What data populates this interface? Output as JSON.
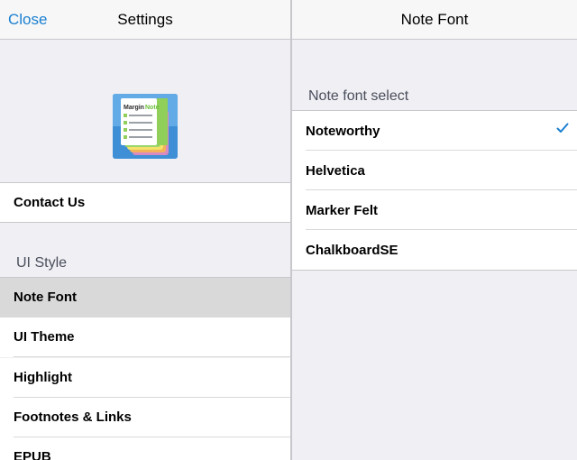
{
  "settings": {
    "close_label": "Close",
    "title": "Settings",
    "app_icon_text": "MarginNote",
    "contact_label": "Contact Us",
    "section_ui_style": "UI Style",
    "items": [
      {
        "label": "Note Font",
        "selected": true
      },
      {
        "label": "UI Theme",
        "selected": false
      },
      {
        "label": "Highlight",
        "selected": false
      },
      {
        "label": "Footnotes & Links",
        "selected": false
      },
      {
        "label": "EPUB",
        "selected": false
      }
    ]
  },
  "note_font": {
    "title": "Note Font",
    "section_label": "Note font select",
    "fonts": [
      {
        "label": "Noteworthy",
        "checked": true
      },
      {
        "label": "Helvetica",
        "checked": false
      },
      {
        "label": "Marker Felt",
        "checked": false
      },
      {
        "label": "ChalkboardSE",
        "checked": false
      }
    ]
  },
  "colors": {
    "accent": "#1a7fd1",
    "background": "#efeff4",
    "selected_row": "#d9d9d9"
  },
  "icons": {
    "checkmark": "checkmark-icon",
    "app_icon": "marginnote-app-icon"
  }
}
